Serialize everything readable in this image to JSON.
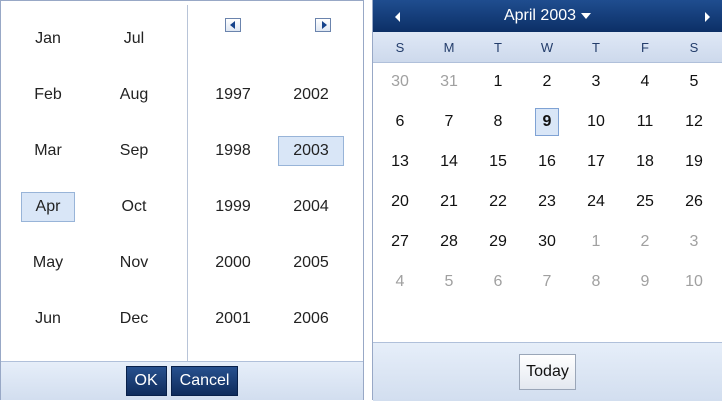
{
  "month_picker": {
    "months_col1": [
      "Jan",
      "Feb",
      "Mar",
      "Apr",
      "May",
      "Jun"
    ],
    "months_col2": [
      "Jul",
      "Aug",
      "Sep",
      "Oct",
      "Nov",
      "Dec"
    ],
    "selected_month": "Apr",
    "years_col1": [
      "1997",
      "1998",
      "1999",
      "2000",
      "2001"
    ],
    "years_col2": [
      "2002",
      "2003",
      "2004",
      "2005",
      "2006"
    ],
    "selected_year": "2003",
    "ok_label": "OK",
    "cancel_label": "Cancel",
    "icons": {
      "prev": "prev-years-icon",
      "next": "next-years-icon"
    }
  },
  "calendar": {
    "title": "April 2003",
    "weekdays": [
      "S",
      "M",
      "T",
      "W",
      "T",
      "F",
      "S"
    ],
    "weeks": [
      [
        "30",
        "31",
        "1",
        "2",
        "3",
        "4",
        "5"
      ],
      [
        "6",
        "7",
        "8",
        "9",
        "10",
        "11",
        "12"
      ],
      [
        "13",
        "14",
        "15",
        "16",
        "17",
        "18",
        "19"
      ],
      [
        "20",
        "21",
        "22",
        "23",
        "24",
        "25",
        "26"
      ],
      [
        "27",
        "28",
        "29",
        "30",
        "1",
        "2",
        "3"
      ],
      [
        "4",
        "5",
        "6",
        "7",
        "8",
        "9",
        "10"
      ]
    ],
    "other_month_days": {
      "0": [
        0,
        1
      ],
      "4": [
        4,
        5,
        6
      ],
      "5": [
        0,
        1,
        2,
        3,
        4,
        5,
        6
      ]
    },
    "today_day": "9",
    "today_label": "Today",
    "icons": {
      "prev": "prev-month-icon",
      "next": "next-month-icon",
      "dropdown": "dropdown-caret-icon"
    }
  },
  "colors": {
    "header": "#12386f",
    "selected_bg": "#d9e6f7",
    "footer": "#dbe5f3"
  }
}
